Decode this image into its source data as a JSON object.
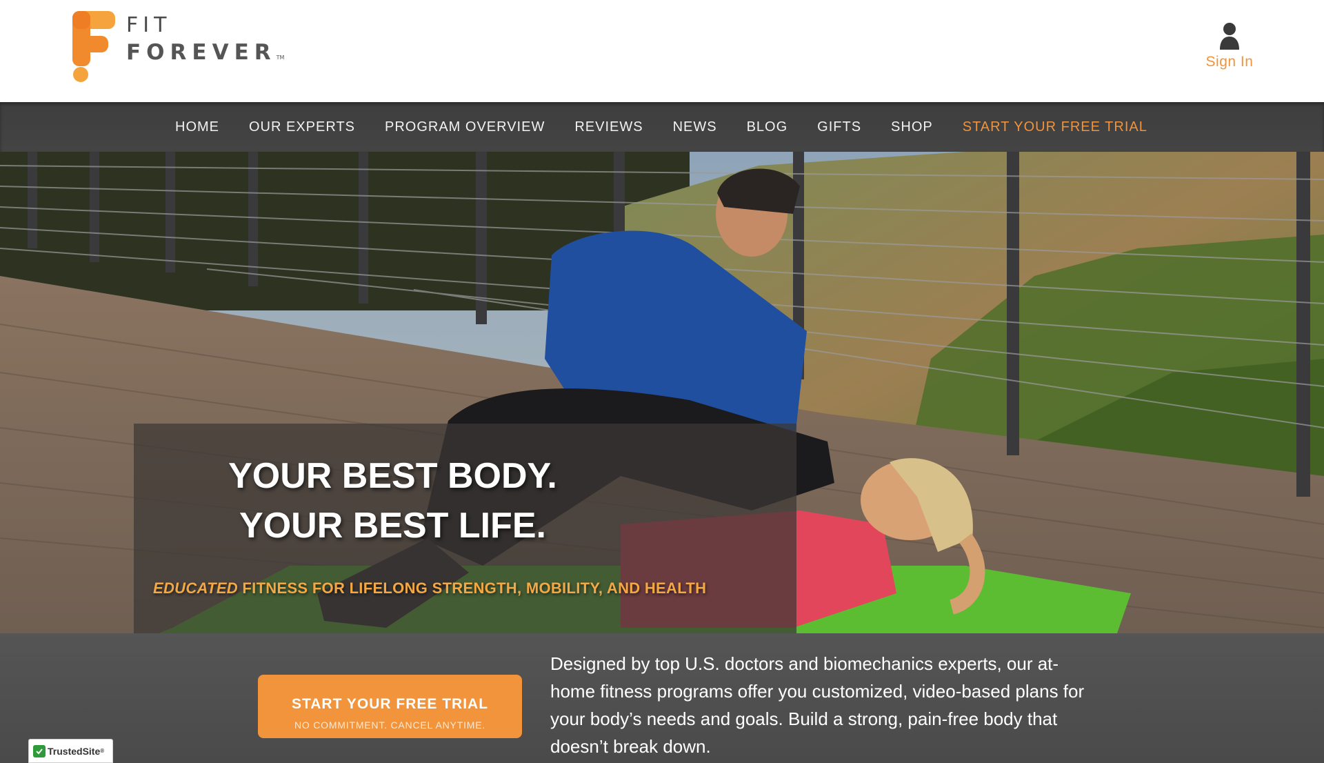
{
  "header": {
    "logo": {
      "line1": "FIT",
      "line2": "FOREVER",
      "tm": "TM"
    },
    "signin": {
      "label": "Sign In",
      "icon": "user-icon"
    }
  },
  "nav": {
    "items": [
      {
        "label": "HOME"
      },
      {
        "label": "OUR EXPERTS"
      },
      {
        "label": "PROGRAM OVERVIEW"
      },
      {
        "label": "REVIEWS"
      },
      {
        "label": "NEWS"
      },
      {
        "label": "BLOG"
      },
      {
        "label": "GIFTS"
      },
      {
        "label": "SHOP"
      },
      {
        "label": "START YOUR FREE TRIAL"
      }
    ]
  },
  "hero": {
    "title_line1": "YOUR BEST BODY.",
    "title_line2": "YOUR BEST LIFE.",
    "tagline_em": "EDUCATED",
    "tagline_rest": " FITNESS FOR LIFELONG STRENGTH, MOBILITY, AND HEALTH"
  },
  "cta": {
    "label": "START YOUR FREE TRIAL",
    "sub": "NO COMMITMENT. CANCEL ANYTIME."
  },
  "description": "Designed by top U.S. doctors and biomechanics experts, our at-home fitness programs offer you customized, video-based plans for your body’s needs and goals. Build a strong, pain-free body that doesn’t break down.",
  "badge": {
    "label": "TrustedSite",
    "tm": "®"
  },
  "colors": {
    "accent": "#f1933a",
    "nav_bg": "#424242",
    "band_bg": "#505050",
    "logo_orange": "#f08a2c"
  }
}
